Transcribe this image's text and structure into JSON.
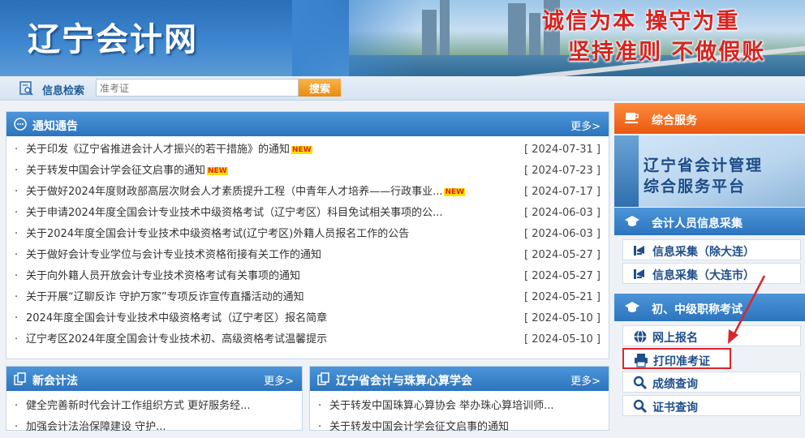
{
  "site": {
    "title": "辽宁会计网"
  },
  "slogans": {
    "line1": "诚信为本 操守为重",
    "line2": "坚持准则 不做假账"
  },
  "search": {
    "label": "信息检索",
    "value": "准考证",
    "button": "搜索"
  },
  "notices": {
    "title": "通知通告",
    "more": "更多>",
    "items": [
      {
        "title": "关于印发《辽宁省推进会计人才振兴的若干措施》的通知",
        "date": "[ 2024-07-31 ]",
        "badge": "NEW"
      },
      {
        "title": "关于转发中国会计学会征文启事的通知",
        "date": "[ 2024-07-23 ]",
        "badge": "NEW"
      },
      {
        "title": "关于做好2024年度财政部高层次财会人才素质提升工程（中青年人才培养——行政事业...",
        "date": "[ 2024-07-17 ]",
        "badge": "NEW"
      },
      {
        "title": "关于申请2024年度全国会计专业技术中级资格考试（辽宁考区）科目免试相关事项的公...",
        "date": "[ 2024-06-03 ]",
        "badge": ""
      },
      {
        "title": "关于2024年度全国会计专业技术中级资格考试(辽宁考区)外籍人员报名工作的公告",
        "date": "[ 2024-06-03 ]",
        "badge": ""
      },
      {
        "title": "关于做好会计专业学位与会计专业技术资格衔接有关工作的通知",
        "date": "[ 2024-05-27 ]",
        "badge": ""
      },
      {
        "title": "关于向外籍人员开放会计专业技术资格考试有关事项的通知",
        "date": "[ 2024-05-27 ]",
        "badge": ""
      },
      {
        "title": "关于开展“辽聊反诈 守护万家”专项反诈宣传直播活动的通知",
        "date": "[ 2024-05-21 ]",
        "badge": ""
      },
      {
        "title": "2024年度全国会计专业技术中级资格考试（辽宁考区）报名简章",
        "date": "[ 2024-05-10 ]",
        "badge": ""
      },
      {
        "title": "辽宁考区2024年度全国会计专业技术初、高级资格考试温馨提示",
        "date": "[ 2024-05-10 ]",
        "badge": ""
      }
    ]
  },
  "fiscal": {
    "title": "新会计法",
    "more": "更多>",
    "items": [
      {
        "title": "健全完善新时代会计工作组织方式 更好服务经..."
      },
      {
        "title": "加强会计法治保障建设 守护..."
      }
    ]
  },
  "abacus": {
    "title": "辽宁省会计与珠算心算学会",
    "more": "更多>",
    "items": [
      {
        "title": "关于转发中国珠算心算协会 举办珠心算培训师..."
      },
      {
        "title": "关于转发中国会计学会征文启事的通知"
      }
    ]
  },
  "sidebar": {
    "service_title": "综合服务",
    "platform_line1": "辽宁省会计管理",
    "platform_line2": "综合服务平台",
    "collect_title": "会计人员信息采集",
    "collect_links": [
      "信息采集（除大连）",
      "信息采集（大连市）"
    ],
    "exam_title": "初、中级职称考试",
    "exam_links": [
      "网上报名",
      "打印准考证",
      "成绩查询",
      "证书查询"
    ]
  },
  "colors": {
    "primary": "#2c74bd",
    "accent_orange": "#e8590f",
    "highlight_red": "#d9262c"
  },
  "icons": [
    "search-icon",
    "chat-icon",
    "copy-icon",
    "cup-icon",
    "graduation-cap-icon",
    "megaphone-icon",
    "globe-icon",
    "printer-icon",
    "magnifier-icon"
  ]
}
